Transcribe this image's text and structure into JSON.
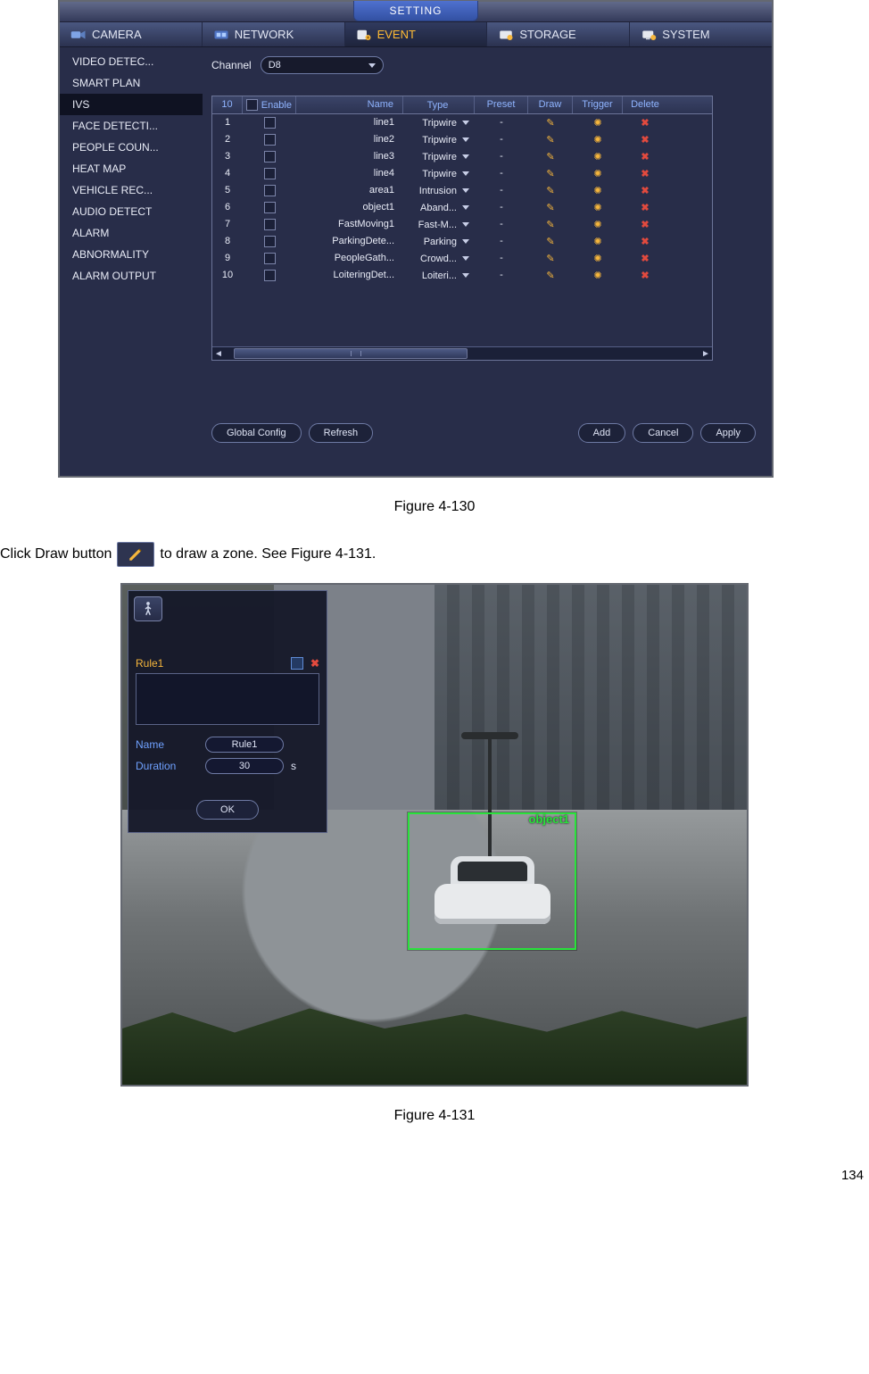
{
  "window": {
    "title": "SETTING",
    "tabs": [
      {
        "label": "CAMERA"
      },
      {
        "label": "NETWORK"
      },
      {
        "label": "EVENT"
      },
      {
        "label": "STORAGE"
      },
      {
        "label": "SYSTEM"
      }
    ],
    "sidebar": [
      "VIDEO DETEC...",
      "SMART PLAN",
      "IVS",
      "FACE DETECTI...",
      "PEOPLE COUN...",
      "HEAT MAP",
      "VEHICLE REC...",
      "AUDIO DETECT",
      "ALARM",
      "ABNORMALITY",
      "ALARM OUTPUT"
    ],
    "channel": {
      "label": "Channel",
      "value": "D8"
    },
    "table": {
      "count": "10",
      "headers": {
        "enable": "Enable",
        "name": "Name",
        "type": "Type",
        "preset": "Preset",
        "draw": "Draw",
        "trigger": "Trigger",
        "delete": "Delete"
      },
      "rows": [
        {
          "idx": "1",
          "name": "line1",
          "type": "Tripwire",
          "preset": "-"
        },
        {
          "idx": "2",
          "name": "line2",
          "type": "Tripwire",
          "preset": "-"
        },
        {
          "idx": "3",
          "name": "line3",
          "type": "Tripwire",
          "preset": "-"
        },
        {
          "idx": "4",
          "name": "line4",
          "type": "Tripwire",
          "preset": "-"
        },
        {
          "idx": "5",
          "name": "area1",
          "type": "Intrusion",
          "preset": "-"
        },
        {
          "idx": "6",
          "name": "object1",
          "type": "Aband...",
          "preset": "-"
        },
        {
          "idx": "7",
          "name": "FastMoving1",
          "type": "Fast-M...",
          "preset": "-"
        },
        {
          "idx": "8",
          "name": "ParkingDete...",
          "type": "Parking",
          "preset": "-"
        },
        {
          "idx": "9",
          "name": "PeopleGath...",
          "type": "Crowd...",
          "preset": "-"
        },
        {
          "idx": "10",
          "name": "LoiteringDet...",
          "type": "Loiteri...",
          "preset": "-"
        }
      ]
    },
    "buttons": {
      "global": "Global Config",
      "refresh": "Refresh",
      "add": "Add",
      "cancel": "Cancel",
      "apply": "Apply"
    }
  },
  "fig1_caption": "Figure 4-130",
  "instruction": {
    "pre": "Click Draw button ",
    "post": " to draw a zone. See Figure 4-131."
  },
  "draw": {
    "rule_tab": "Rule1",
    "name_label": "Name",
    "name_value": "Rule1",
    "dur_label": "Duration",
    "dur_value": "30",
    "dur_unit": "s",
    "ok": "OK",
    "zone_label": "object1"
  },
  "fig2_caption": "Figure 4-131",
  "page_number": "134"
}
